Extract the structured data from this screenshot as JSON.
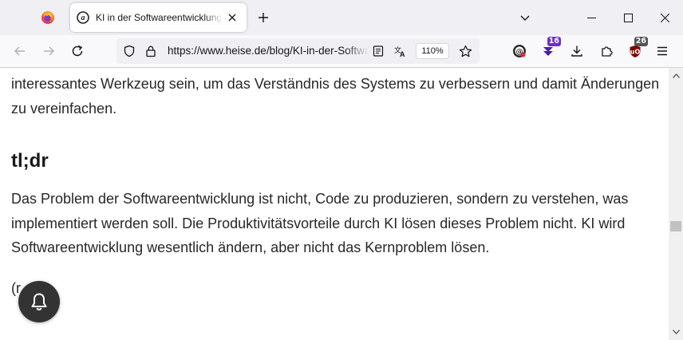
{
  "tabs": {
    "active_title": "KI in der Softwareentwicklung: Kein großer Einfluss",
    "firefox_view_icon": "firefox-logo-icon",
    "close_icon": "close-icon",
    "new_tab_icon": "plus-icon",
    "list_icon": "chevron-down-icon"
  },
  "window": {
    "minimize_icon": "minimize-icon",
    "maximize_icon": "maximize-icon",
    "close_icon": "close-icon"
  },
  "nav": {
    "url": "https://www.heise.de/blog/KI-in-der-Softwareentwicklung",
    "zoom": "110%",
    "extensions": [
      {
        "name": "extension-purple",
        "badge": "16",
        "badge_color": "#6b2cd9"
      },
      {
        "name": "ublock-origin",
        "badge": "26",
        "badge_color": "#555555"
      }
    ]
  },
  "article": {
    "p1": "interessantes Werkzeug sein, um das Verständnis des Systems zu verbessern und damit Änderungen zu vereinfachen.",
    "heading": "tl;dr",
    "p2": "Das Problem der Softwareentwicklung ist nicht, Code zu produzieren, sondern zu verstehen, was implementiert werden soll. Die Produktivitätsvorteile durch KI lösen dieses Problem nicht. KI wird Softwareentwicklung wesentlich ändern, aber nicht das Kernproblem lösen.",
    "p3": "(r"
  },
  "colors": {
    "tab_strip": "#f0f0f4",
    "nav_bar": "#f9f9fb",
    "bell_bg": "#333333"
  }
}
